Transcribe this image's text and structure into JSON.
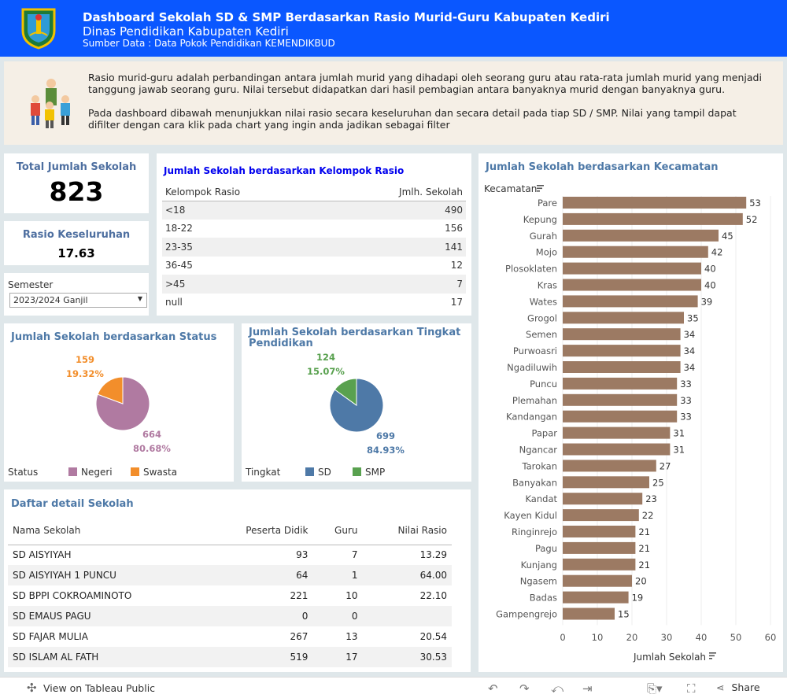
{
  "header": {
    "title": "Dashboard Sekolah SD & SMP Berdasarkan Rasio Murid-Guru Kabupaten Kediri",
    "subtitle": "Dinas Pendidikan Kabupaten Kediri",
    "source": "Sumber Data : Data Pokok Pendidikan KEMENDIKBUD"
  },
  "intro": {
    "p1": "Rasio murid-guru adalah perbandingan antara jumlah murid yang dihadapi oleh seorang guru atau rata-rata jumlah murid yang menjadi tanggung jawab seorang guru. Nilai tersebut didapatkan dari hasil pembagian antara banyaknya murid dengan banyaknya guru.",
    "p2": "Pada dashboard dibawah menunjukkan nilai rasio secara keseluruhan dan secara detail pada tiap SD / SMP. Nilai yang tampil dapat difilter dengan cara klik pada chart yang ingin anda jadikan sebagai filter"
  },
  "kpi": {
    "total_label": "Total Jumlah Sekolah",
    "total_value": "823",
    "rasio_label": "Rasio Keseluruhan",
    "rasio_value": "17.63"
  },
  "semester": {
    "label": "Semester",
    "value": "2023/2024 Ganjil"
  },
  "rasio_table": {
    "title": "Jumlah Sekolah berdasarkan Kelompok Rasio",
    "headers": [
      "Kelompok Rasio",
      "Jmlh. Sekolah"
    ],
    "rows": [
      {
        "k": "<18",
        "v": "490"
      },
      {
        "k": "18-22",
        "v": "156"
      },
      {
        "k": "23-35",
        "v": "141"
      },
      {
        "k": "36-45",
        "v": "12"
      },
      {
        "k": ">45",
        "v": "7"
      },
      {
        "k": "null",
        "v": "17"
      }
    ]
  },
  "status_pie": {
    "title": "Jumlah Sekolah berdasarkan Status",
    "legend_title": "Status",
    "slices": [
      {
        "name": "Negeri",
        "value": 664,
        "pct": "80.68%",
        "color": "#b07aa1"
      },
      {
        "name": "Swasta",
        "value": 159,
        "pct": "19.32%",
        "color": "#f28e2b"
      }
    ]
  },
  "tingkat_pie": {
    "title": "Jumlah Sekolah berdasarkan Tingkat Pendidikan",
    "legend_title": "Tingkat",
    "slices": [
      {
        "name": "SD",
        "value": 699,
        "pct": "84.93%",
        "color": "#4e79a7"
      },
      {
        "name": "SMP",
        "value": 124,
        "pct": "15.07%",
        "color": "#59a14f"
      }
    ]
  },
  "detail": {
    "title": "Daftar detail Sekolah",
    "headers": [
      "Nama Sekolah",
      "Peserta Didik",
      "Guru",
      "Nilai Rasio"
    ],
    "rows": [
      [
        "SD AISYIYAH",
        "93",
        "7",
        "13.29"
      ],
      [
        "SD AISYIYAH 1 PUNCU",
        "64",
        "1",
        "64.00"
      ],
      [
        "SD BPPI COKROAMINOTO",
        "221",
        "10",
        "22.10"
      ],
      [
        "SD EMAUS PAGU",
        "0",
        "0",
        ""
      ],
      [
        "SD FAJAR MULIA",
        "267",
        "13",
        "20.54"
      ],
      [
        "SD ISLAM AL FATH",
        "519",
        "17",
        "30.53"
      ]
    ]
  },
  "chart_data": {
    "type": "bar",
    "title": "Jumlah Sekolah berdasarkan Kecamatan",
    "ylabel": "Kecamatan",
    "xlabel": "Jumlah Sekolah",
    "categories": [
      "Pare",
      "Kepung",
      "Gurah",
      "Mojo",
      "Plosoklaten",
      "Kras",
      "Wates",
      "Grogol",
      "Semen",
      "Purwoasri",
      "Ngadiluwih",
      "Puncu",
      "Plemahan",
      "Kandangan",
      "Papar",
      "Ngancar",
      "Tarokan",
      "Banyakan",
      "Kandat",
      "Kayen Kidul",
      "Ringinrejo",
      "Pagu",
      "Kunjang",
      "Ngasem",
      "Badas",
      "Gampengrejo"
    ],
    "values": [
      53,
      52,
      45,
      42,
      40,
      40,
      39,
      35,
      34,
      34,
      34,
      33,
      33,
      33,
      31,
      31,
      27,
      25,
      23,
      22,
      21,
      21,
      21,
      20,
      19,
      15
    ],
    "xlim": [
      0,
      60
    ],
    "ticks": [
      "0",
      "10",
      "20",
      "30",
      "40",
      "50",
      "60"
    ],
    "color": "#9c7a63",
    "grid": true
  },
  "footer": {
    "view_label": "View on Tableau Public",
    "share_label": "Share"
  }
}
